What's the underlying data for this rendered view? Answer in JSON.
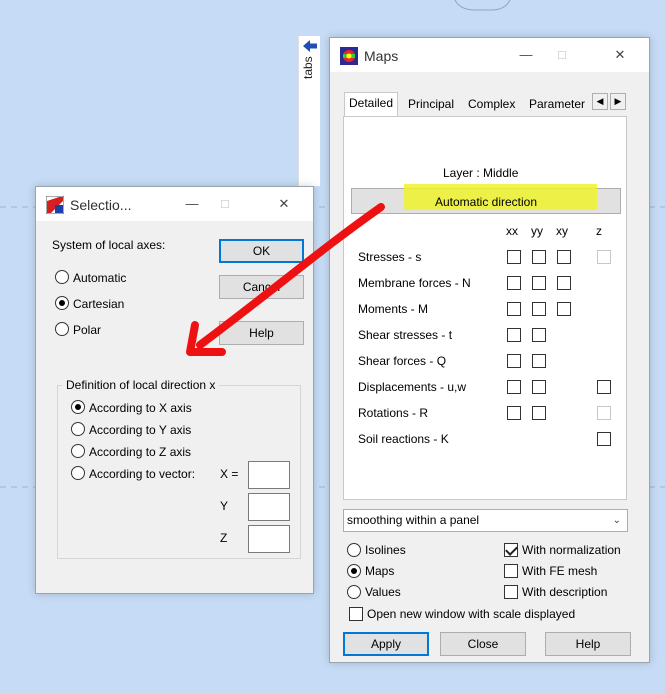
{
  "tabs_strip": {
    "label": "tabs",
    "arrow_icon": "left-arrow-icon"
  },
  "maps": {
    "title": "Maps",
    "tabs": [
      "Detailed",
      "Principal",
      "Complex",
      "Parameter"
    ],
    "layer_text": "Layer : Middle",
    "auto_direction_label": "Automatic direction",
    "columns": [
      "xx",
      "yy",
      "xy",
      "z"
    ],
    "rows": [
      {
        "label": "Stresses - s",
        "cells": [
          "box",
          "box",
          "box",
          "disabled"
        ]
      },
      {
        "label": "Membrane forces - N",
        "cells": [
          "box",
          "box",
          "box",
          "none"
        ]
      },
      {
        "label": "Moments - M",
        "cells": [
          "box",
          "box",
          "box",
          "none"
        ]
      },
      {
        "label": "Shear stresses - t",
        "cells": [
          "box",
          "box",
          "none",
          "none"
        ]
      },
      {
        "label": "Shear forces - Q",
        "cells": [
          "box",
          "box",
          "none",
          "none"
        ]
      },
      {
        "label": "Displacements - u,w",
        "cells": [
          "box",
          "box",
          "none",
          "box"
        ]
      },
      {
        "label": "Rotations - R",
        "cells": [
          "box",
          "box",
          "none",
          "disabled"
        ]
      },
      {
        "label": "Soil reactions - K",
        "cells": [
          "none",
          "none",
          "none",
          "box"
        ]
      }
    ],
    "smoothing_value": "smoothing within a panel",
    "display_options": [
      {
        "label": "Isolines",
        "selected": false
      },
      {
        "label": "Maps",
        "selected": true
      },
      {
        "label": "Values",
        "selected": false
      }
    ],
    "checks": [
      {
        "label": "With normalization",
        "checked": true
      },
      {
        "label": "With FE mesh",
        "checked": false
      },
      {
        "label": "With description",
        "checked": false
      }
    ],
    "open_window_label": "Open new window with scale displayed",
    "apply_label": "Apply",
    "close_label": "Close",
    "help_label": "Help"
  },
  "selection": {
    "title": "Selectio...",
    "axes_label": "System of local axes:",
    "axes_options": [
      {
        "label": "Automatic",
        "selected": false
      },
      {
        "label": "Cartesian",
        "selected": true
      },
      {
        "label": "Polar",
        "selected": false
      }
    ],
    "ok_label": "OK",
    "cancel_label": "Cancel",
    "help_label": "Help",
    "group_title": "Definition of local direction x",
    "direction_options": [
      {
        "label": "According to X axis",
        "selected": true
      },
      {
        "label": "According to Y axis",
        "selected": false
      },
      {
        "label": "According to Z axis",
        "selected": false
      },
      {
        "label": "According to vector:",
        "selected": false
      }
    ],
    "vector_labels": [
      "X =",
      "Y",
      "Z"
    ]
  },
  "colors": {
    "background": "#c6dbf5",
    "highlight": "#eef22a",
    "annotation_arrow": "#ee1111",
    "accent": "#0078d7"
  }
}
